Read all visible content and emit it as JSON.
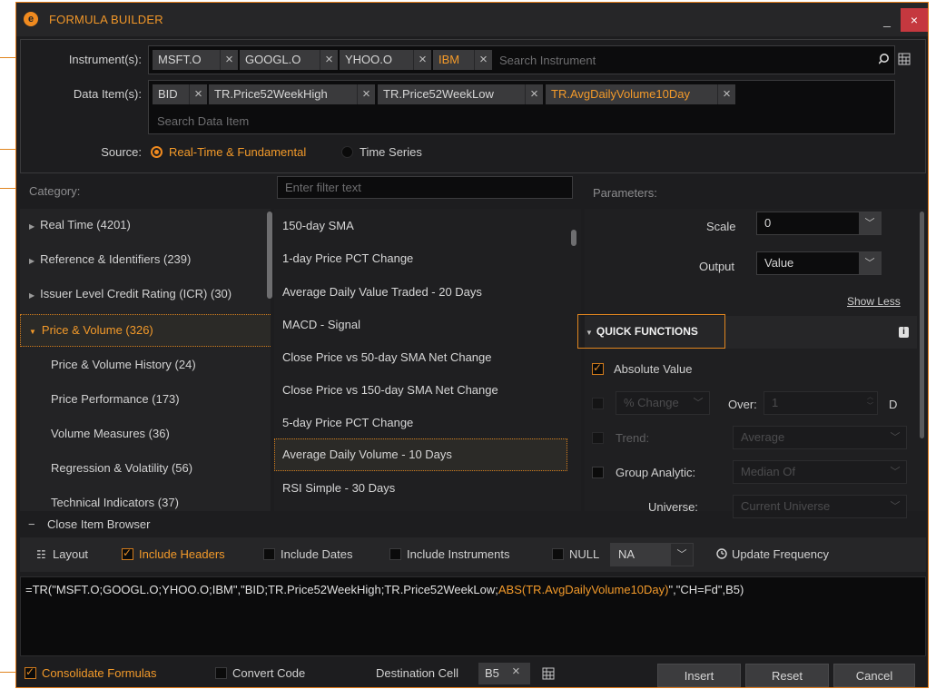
{
  "titlebar": {
    "title": "FORMULA BUILDER",
    "minimize": "_",
    "close": "×"
  },
  "instruments": {
    "label": "Instrument(s):",
    "chips": [
      "MSFT.O",
      "GOOGL.O",
      "YHOO.O",
      "IBM"
    ],
    "placeholder": "Search Instrument"
  },
  "data_items": {
    "label": "Data Item(s):",
    "chips": [
      "BID",
      "TR.Price52WeekHigh",
      "TR.Price52WeekLow",
      "TR.AvgDailyVolume10Day"
    ],
    "placeholder": "Search Data Item"
  },
  "source": {
    "label": "Source:",
    "options": [
      "Real-Time & Fundamental",
      "Time Series"
    ],
    "selected": "Real-Time & Fundamental"
  },
  "category": {
    "label": "Category:",
    "filter_placeholder": "Enter filter text"
  },
  "parameters_label": "Parameters:",
  "categories": [
    {
      "label": "Real Time (4201)",
      "type": "parent"
    },
    {
      "label": "Reference & Identifiers (239)",
      "type": "parent"
    },
    {
      "label": "Issuer Level Credit Rating (ICR) (30)",
      "type": "parent"
    },
    {
      "label": "Price & Volume (326)",
      "type": "expanded"
    },
    {
      "label": "Price & Volume History (24)",
      "type": "child"
    },
    {
      "label": "Price Performance (173)",
      "type": "child"
    },
    {
      "label": "Volume Measures (36)",
      "type": "child"
    },
    {
      "label": "Regression & Volatility (56)",
      "type": "child"
    },
    {
      "label": "Technical Indicators (37)",
      "type": "child"
    }
  ],
  "items": [
    "150-day SMA",
    "1-day Price PCT Change",
    "Average Daily Value Traded - 20 Days",
    "MACD - Signal",
    "Close Price vs 50-day SMA Net Change",
    "Close Price vs 150-day SMA Net Change",
    "5-day Price PCT Change",
    "Average Daily Volume - 10 Days",
    "RSI Simple - 30 Days"
  ],
  "selected_item": "Average Daily Volume - 10 Days",
  "params": {
    "scale_label": "Scale",
    "scale_value": "0",
    "output_label": "Output",
    "output_value": "Value",
    "show_less": "Show Less",
    "quick_functions": "QUICK FUNCTIONS",
    "info_icon": "i",
    "absolute_value": "Absolute Value",
    "pct_change": "% Change",
    "over_label": "Over:",
    "over_value": "1",
    "over_unit": "D",
    "trend_label": "Trend:",
    "trend_value": "Average",
    "group_label": "Group Analytic:",
    "group_value": "Median Of",
    "universe_label": "Universe:",
    "universe_value": "Current Universe"
  },
  "item_browser": {
    "toggle": "−",
    "label": "Close Item Browser"
  },
  "options_bar": {
    "layout": "Layout",
    "include_headers": "Include Headers",
    "include_dates": "Include Dates",
    "include_instruments": "Include Instruments",
    "null_label": "NULL",
    "null_value": "NA",
    "update_frequency": "Update Frequency"
  },
  "formula": {
    "before": "=TR(\"MSFT.O;GOOGL.O;YHOO.O;IBM\",\"BID;TR.Price52WeekHigh;TR.Price52WeekLow;",
    "highlight": "ABS(TR.AvgDailyVolume10Day)",
    "after": "\",\"CH=Fd\",B5)"
  },
  "footer": {
    "consolidate": "Consolidate Formulas",
    "convert": "Convert Code",
    "dest_label": "Destination Cell",
    "dest_value": "B5",
    "insert": "Insert",
    "reset": "Reset",
    "cancel": "Cancel"
  },
  "colors": {
    "accent": "#f08a1f",
    "background": "#1d1d1f",
    "panel": "#232325",
    "close": "#c5383f"
  }
}
